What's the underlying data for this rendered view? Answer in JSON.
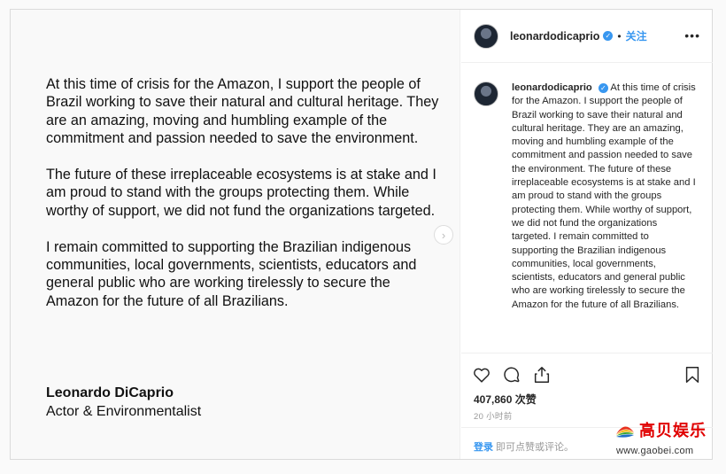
{
  "post_image": {
    "paragraphs": [
      "At this time of crisis for the Amazon, I support the people of Brazil working to save their natural and cultural heritage. They are an amazing, moving and humbling example of the commitment and passion needed to save the environment.",
      "The future of these irreplaceable ecosystems is at stake and I am proud to stand with the groups protecting them. While worthy of support, we did not fund the organizations targeted.",
      "I remain committed to supporting the Brazilian indigenous communities, local governments, scientists, educators and general public who are working tirelessly to secure the Amazon for the future of all Brazilians."
    ],
    "signature_name": "Leonardo DiCaprio",
    "signature_title": "Actor & Environmentalist",
    "next_icon": "›"
  },
  "header": {
    "username": "leonardodicaprio",
    "verified_icon": "✓",
    "separator": "•",
    "follow_label": "关注",
    "more_icon": "•••"
  },
  "caption": {
    "username": "leonardodicaprio",
    "text": "At this time of crisis for the Amazon. I support the people of Brazil working to save their natural and cultural heritage. They are an amazing, moving and humbling example of the commitment and passion needed to save the environment. The future of these irreplaceable ecosystems is at stake and I am proud to stand with the groups protecting them. While worthy of support, we did not fund the organizations targeted. I remain committed to supporting the Brazilian indigenous communities, local governments, scientists, educators and general public who are working tirelessly to secure the Amazon for the future of all Brazilians."
  },
  "actions": {
    "likes": "407,860 次赞",
    "time": "20 小时前"
  },
  "comment_bar": {
    "login_label": "登录",
    "prompt": " 即可点赞或评论。"
  },
  "watermark": {
    "brand": "高贝娱乐",
    "url": "www.gaobei.com"
  },
  "colors": {
    "accent": "#3897f0",
    "watermark_red": "#e00000"
  }
}
